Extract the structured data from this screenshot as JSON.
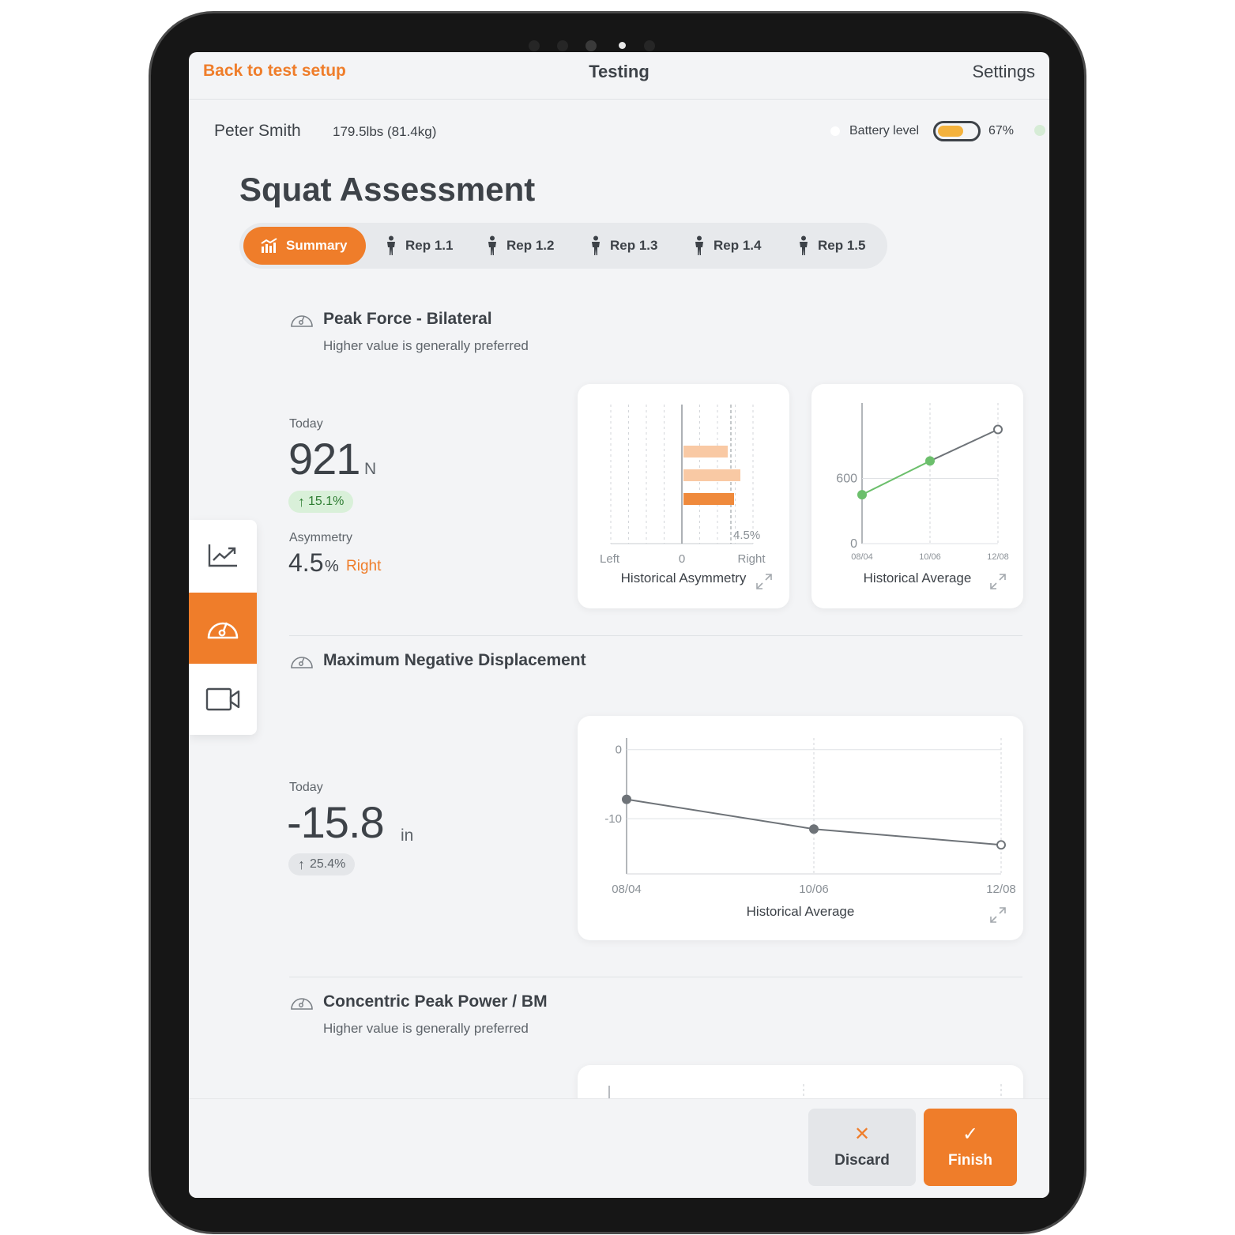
{
  "nav": {
    "back_label": "Back to test setup",
    "title": "Testing",
    "settings_label": "Settings"
  },
  "user": {
    "name": "Peter Smith",
    "weight": "179.5lbs (81.4kg)"
  },
  "battery": {
    "label": "Battery level",
    "percent_text": "67%",
    "level": 0.67
  },
  "page_title": "Squat Assessment",
  "tabs": [
    {
      "label": "Summary",
      "icon": "bar-chart-icon",
      "active": true
    },
    {
      "label": "Rep 1.1",
      "icon": "person-icon"
    },
    {
      "label": "Rep 1.2",
      "icon": "person-icon"
    },
    {
      "label": "Rep 1.3",
      "icon": "person-icon"
    },
    {
      "label": "Rep 1.4",
      "icon": "person-icon"
    },
    {
      "label": "Rep 1.5",
      "icon": "person-icon"
    }
  ],
  "side_rail": [
    {
      "icon": "trend-chart-icon",
      "active": false
    },
    {
      "icon": "gauge-icon",
      "active": true
    },
    {
      "icon": "video-camera-icon",
      "active": false
    }
  ],
  "sections": {
    "peak_force": {
      "title": "Peak Force - Bilateral",
      "subtitle": "Higher value is generally preferred",
      "today_label": "Today",
      "value": "921",
      "unit": "N",
      "change": "15.1%",
      "asymmetry_label": "Asymmetry",
      "asymmetry_value": "4.5",
      "asymmetry_unit": "%",
      "asymmetry_side": "Right",
      "asym_card_title": "Historical Asymmetry",
      "avg_card_title": "Historical Average"
    },
    "neg_disp": {
      "title": "Maximum Negative Displacement",
      "today_label": "Today",
      "value": "-15.8",
      "unit": "in",
      "change": "25.4%",
      "card_title": "Historical Average"
    },
    "conc_power": {
      "title": "Concentric Peak Power / BM",
      "subtitle": "Higher value is generally preferred"
    }
  },
  "chart_data": [
    {
      "type": "bar",
      "orientation": "horizontal",
      "categories": [
        "1",
        "2",
        "3"
      ],
      "values": [
        2.8,
        3.6,
        3.2
      ],
      "colors": [
        "#f9c9a4",
        "#f9c9a4",
        "#ef8a3c"
      ],
      "x_tick_labels": [
        "Left",
        "0",
        "Right"
      ],
      "annotation": "4.5%",
      "reference_value": 3.1,
      "xlim": [
        -4.5,
        4.5
      ]
    },
    {
      "type": "line",
      "x": [
        "08/04",
        "10/06",
        "12/08"
      ],
      "series": [
        {
          "values": [
            450,
            760,
            1050
          ],
          "color": "#6cbf6c"
        }
      ],
      "y_tick_labels": [
        "0",
        "600"
      ],
      "ylim": [
        0,
        1250
      ]
    },
    {
      "type": "line",
      "x": [
        "08/04",
        "10/06",
        "12/08"
      ],
      "series": [
        {
          "values": [
            -7.2,
            -11.5,
            -13.8
          ],
          "color": "#6e7378"
        }
      ],
      "y_tick_labels": [
        "0",
        "-10"
      ],
      "ylim": [
        -18,
        1
      ]
    }
  ],
  "footer": {
    "discard_label": "Discard",
    "finish_label": "Finish"
  },
  "colors": {
    "accent": "#ef7d2a",
    "text": "#3d4248",
    "positive": "#2e7d32",
    "battery": "#f4b23d"
  }
}
